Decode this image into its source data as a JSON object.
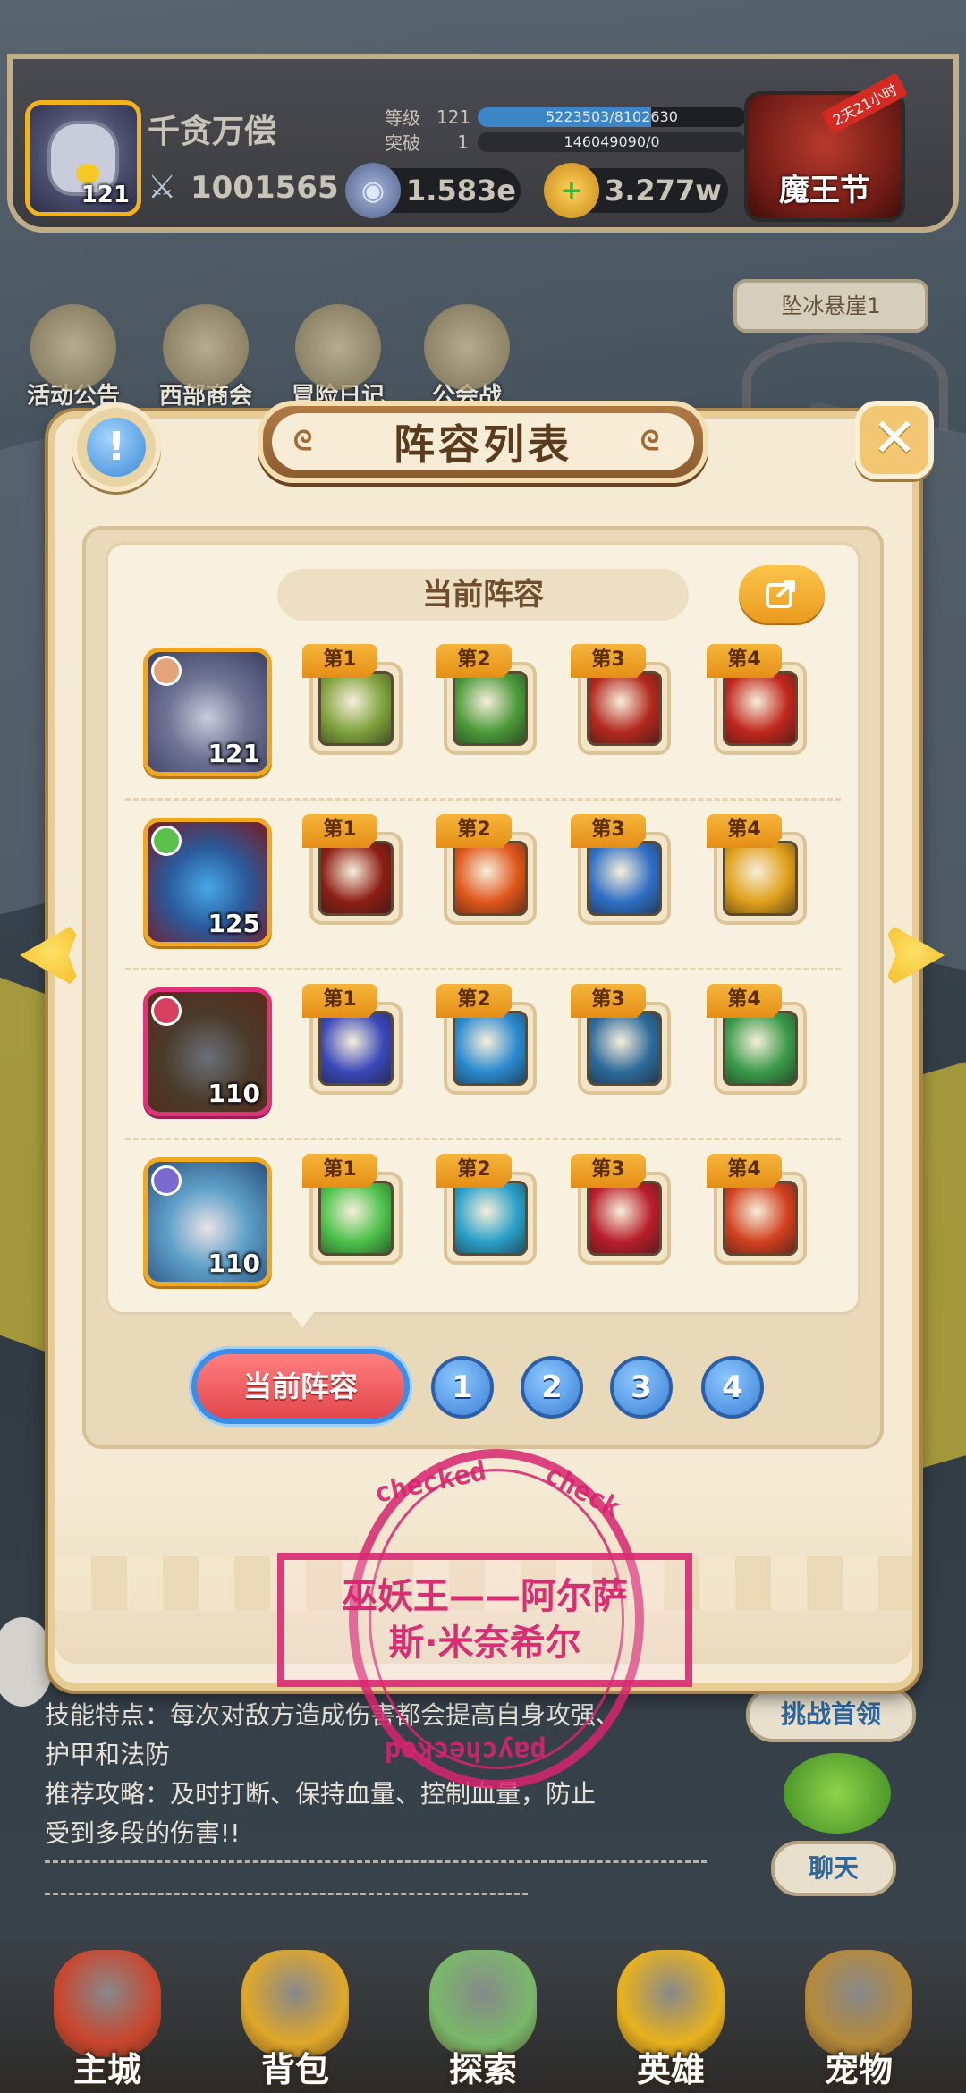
{
  "header": {
    "player_name": "千贪万偿",
    "avatar_level": "121",
    "power": "1001565",
    "stats": [
      {
        "label": "等级",
        "value": "121",
        "bar_text": "5223503/8102630",
        "progress": 0.645
      },
      {
        "label": "突破",
        "value": "1",
        "bar_text": "146049090/0",
        "progress": 1.0
      }
    ],
    "resources": [
      {
        "icon": "blue-gem-icon",
        "value": "1.583e"
      },
      {
        "icon": "gold-coin-plus-icon",
        "value": "3.277w"
      }
    ],
    "event": {
      "label": "魔王节",
      "ribbon": "2天21小时"
    }
  },
  "shortcuts": [
    {
      "label": "活动公告",
      "icon": "scroll-icon"
    },
    {
      "label": "西部商会",
      "icon": "merchant-icon"
    },
    {
      "label": "冒险日记",
      "icon": "journal-icon"
    },
    {
      "label": "公会战",
      "icon": "guild-shield-icon"
    }
  ],
  "location": "坠冰悬崖1",
  "modal": {
    "title": "阵容列表",
    "section": "当前阵容",
    "rows": [
      {
        "hero_level": "121",
        "hero_color": "#f0a820",
        "skills": [
          {
            "tag": "第1",
            "color": "#7fa23c"
          },
          {
            "tag": "第2",
            "color": "#4b9a3a"
          },
          {
            "tag": "第3",
            "color": "#b2281e"
          },
          {
            "tag": "第4",
            "color": "#c0261c"
          }
        ]
      },
      {
        "hero_level": "125",
        "hero_color": "#f0a820",
        "skills": [
          {
            "tag": "第1",
            "color": "#8c1e14"
          },
          {
            "tag": "第2",
            "color": "#e0561a"
          },
          {
            "tag": "第3",
            "color": "#2f6fc4"
          },
          {
            "tag": "第4",
            "color": "#e0a01a"
          }
        ]
      },
      {
        "hero_level": "110",
        "hero_color": "#e0317a",
        "skills": [
          {
            "tag": "第1",
            "color": "#3a48b8"
          },
          {
            "tag": "第2",
            "color": "#2a8ad0"
          },
          {
            "tag": "第3",
            "color": "#2d6a9a"
          },
          {
            "tag": "第4",
            "color": "#3a9a4a"
          }
        ]
      },
      {
        "hero_level": "110",
        "hero_color": "#f0a820",
        "skills": [
          {
            "tag": "第1",
            "color": "#4cc24a"
          },
          {
            "tag": "第2",
            "color": "#2aa0c8"
          },
          {
            "tag": "第3",
            "color": "#b81e2a"
          },
          {
            "tag": "第4",
            "color": "#d2401e"
          }
        ]
      }
    ],
    "tabs": {
      "current": "当前阵容",
      "numbers": [
        "1",
        "2",
        "3",
        "4"
      ]
    }
  },
  "stamp": {
    "word_top": "checked",
    "word_right": "check",
    "word_bottom": "paychecked",
    "line1": "巫妖王——阿尔萨",
    "line2": "斯·米奈希尔"
  },
  "background_text": {
    "line1": "技能特点：每次对敌方造成伤害都会提高自身攻强、",
    "line2": "护甲和法防",
    "line3": "推荐攻略：及时打断、保持血量、控制血量，防止",
    "line4": "受到多段的伤害!!"
  },
  "side_buttons": {
    "challenge": "挑战首领",
    "chat": "聊天"
  },
  "nav": [
    {
      "label": "主城",
      "icon": "castle-icon",
      "color": "#c9462e"
    },
    {
      "label": "背包",
      "icon": "backpack-icon",
      "color": "#e0a82a"
    },
    {
      "label": "探索",
      "icon": "map-scroll-icon",
      "color": "#7ab86a"
    },
    {
      "label": "英雄",
      "icon": "hero-face-icon",
      "color": "#e8b21e"
    },
    {
      "label": "宠物",
      "icon": "pet-tree-icon",
      "color": "#b58a3a"
    }
  ]
}
